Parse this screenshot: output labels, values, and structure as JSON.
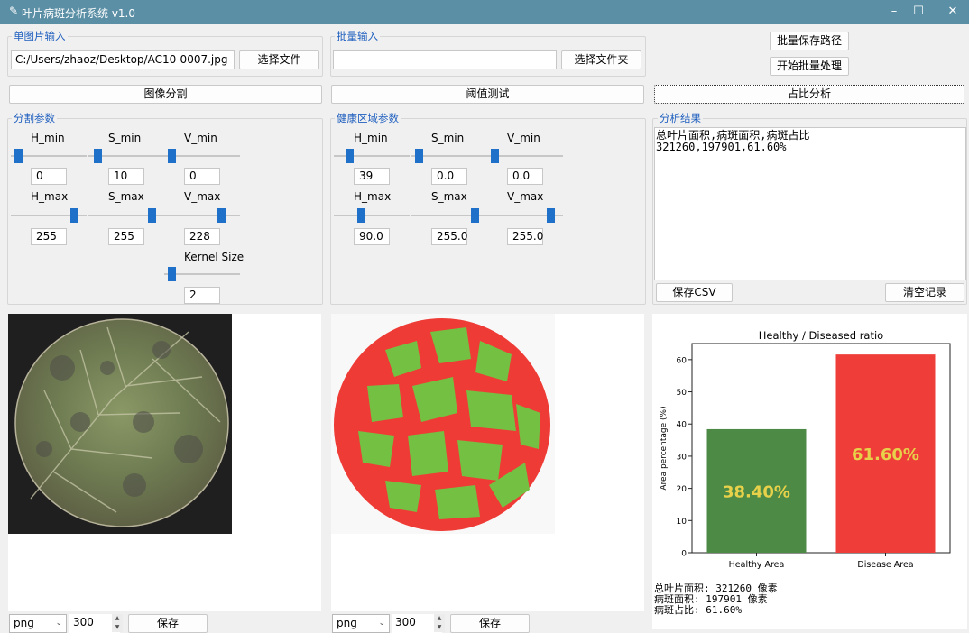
{
  "window": {
    "title": "叶片病斑分析系统 v1.0",
    "controls": [
      "–",
      "☐",
      "✕"
    ]
  },
  "single_input": {
    "label": "单图片输入",
    "path": "C:/Users/zhaoz/Desktop/AC10-0007.jpg",
    "choose_btn": "选择文件"
  },
  "batch_input": {
    "label": "批量输入",
    "path": "",
    "choose_btn": "选择文件夹"
  },
  "batch_save_path_btn": "批量保存路径",
  "start_batch_btn": "开始批量处理",
  "actions": {
    "segment": "图像分割",
    "threshold_test": "阈值测试",
    "ratio_analysis": "占比分析"
  },
  "seg_params": {
    "label": "分割参数",
    "h_min": {
      "label": "H_min",
      "value": "0",
      "level": 0.0
    },
    "s_min": {
      "label": "S_min",
      "value": "10",
      "level": 0.04
    },
    "v_min": {
      "label": "V_min",
      "value": "0",
      "level": 0.0
    },
    "h_max": {
      "label": "H_max",
      "value": "255",
      "level": 1.0
    },
    "s_max": {
      "label": "S_max",
      "value": "255",
      "level": 1.0
    },
    "v_max": {
      "label": "V_max",
      "value": "228",
      "level": 0.89
    },
    "kernel": {
      "label": "Kernel Size",
      "value": "2",
      "level": 0.0
    }
  },
  "healthy_params": {
    "label": "健康区域参数",
    "h_min": {
      "label": "H_min",
      "value": "39",
      "level": 0.15
    },
    "s_min": {
      "label": "S_min",
      "value": "0.0",
      "level": 0.0
    },
    "v_min": {
      "label": "V_min",
      "value": "0.0",
      "level": 0.0
    },
    "h_max": {
      "label": "H_max",
      "value": "90.0",
      "level": 0.35
    },
    "s_max": {
      "label": "S_max",
      "value": "255.0",
      "level": 1.0
    },
    "v_max": {
      "label": "V_max",
      "value": "255.0",
      "level": 1.0
    }
  },
  "results": {
    "label": "分析结果",
    "lines": [
      "总叶片面积,病斑面积,病斑占比",
      "321260,197901,61.60%"
    ],
    "save_csv_btn": "保存CSV",
    "clear_btn": "清空记录"
  },
  "chart_data": {
    "type": "bar",
    "title": "Healthy / Diseased ratio",
    "ylabel": "Area percentage (%)",
    "xlabel": "",
    "categories": [
      "Healthy Area",
      "Disease Area"
    ],
    "values": [
      38.4,
      61.6
    ],
    "value_labels": [
      "38.40%",
      "61.60%"
    ],
    "colors": [
      "#4c8a45",
      "#ef3e3a"
    ],
    "label_color": "#e8d14a",
    "ylim": [
      0,
      65
    ],
    "yticks": [
      0,
      10,
      20,
      30,
      40,
      50,
      60
    ],
    "grid": false
  },
  "summary": {
    "lines": [
      "总叶片面积: 321260 像素",
      "病斑面积: 197901 像素",
      "病斑占比: 61.60%"
    ]
  },
  "bottom_left": {
    "format": "png",
    "dpi": "300",
    "save_btn": "保存"
  },
  "bottom_mid": {
    "format": "png",
    "dpi": "300",
    "save_btn": "保存"
  }
}
